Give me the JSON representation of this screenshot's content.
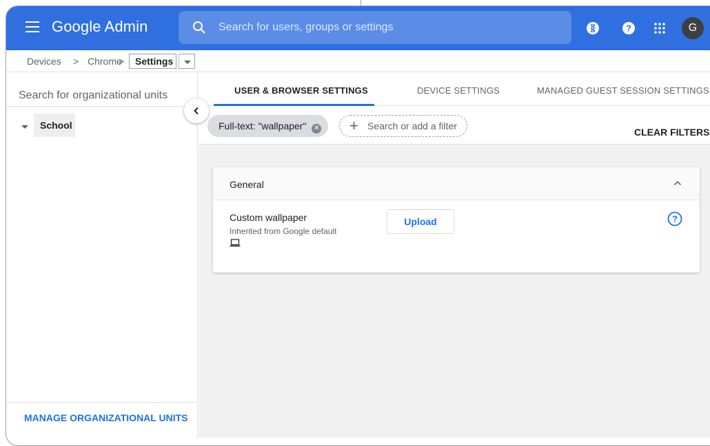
{
  "header": {
    "brand_google": "Google",
    "brand_admin": "Admin",
    "search_placeholder": "Search for users, groups or settings",
    "avatar_letter": "G",
    "icons": [
      "menu-icon",
      "search-icon",
      "hourglass-icon",
      "help-icon",
      "apps-grid-icon"
    ],
    "color": "#2f6fdf"
  },
  "breadcrumb": {
    "items": [
      "Devices",
      "Chrome"
    ],
    "separator": ">",
    "current": "Settings"
  },
  "sidebar": {
    "search_placeholder": "Search for organizational units",
    "tree": [
      {
        "label": "School",
        "expanded": true,
        "selected": true
      }
    ],
    "manage_link": "MANAGE ORGANIZATIONAL UNITS"
  },
  "main": {
    "tabs": [
      {
        "label": "USER & BROWSER SETTINGS",
        "active": true
      },
      {
        "label": "DEVICE SETTINGS",
        "active": false
      },
      {
        "label": "MANAGED GUEST SESSION SETTINGS",
        "active": false
      }
    ],
    "filter_chip": "Full-text: \"wallpaper\"",
    "add_filter_placeholder": "Search or add a filter",
    "clear_filters": "CLEAR FILTERS",
    "card": {
      "title": "General",
      "setting_name": "Custom wallpaper",
      "setting_source": "Inherited from Google default",
      "upload_label": "Upload"
    }
  }
}
